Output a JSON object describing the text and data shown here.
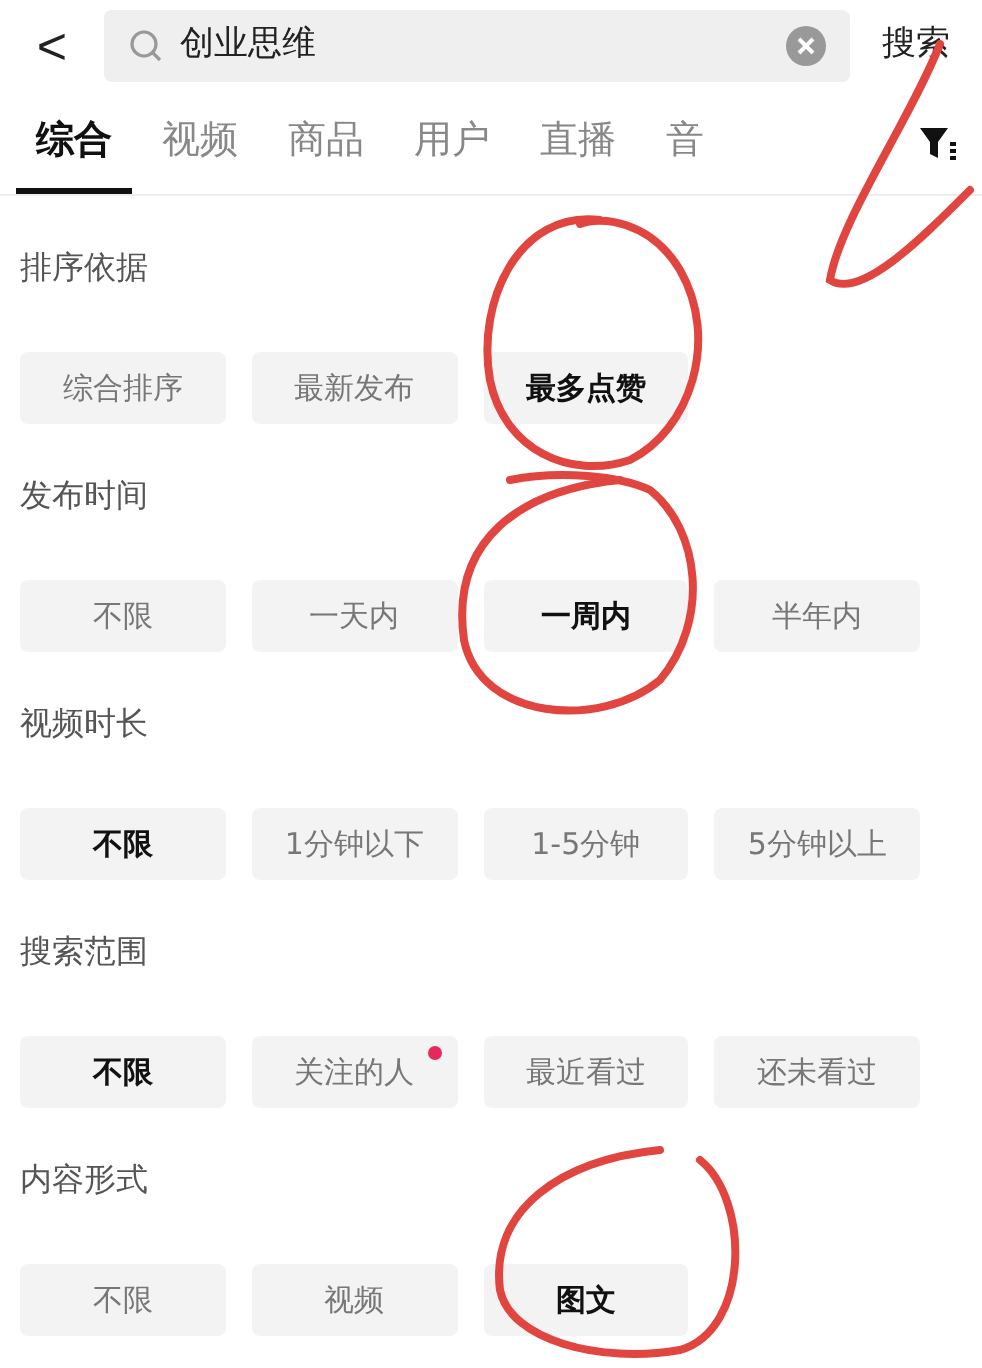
{
  "search_bar": {
    "back": "<",
    "value": "创业思维",
    "submit": "搜索"
  },
  "tabs": [
    {
      "label": "综合",
      "selected": true
    },
    {
      "label": "视频",
      "selected": false
    },
    {
      "label": "商品",
      "selected": false
    },
    {
      "label": "用户",
      "selected": false
    },
    {
      "label": "直播",
      "selected": false
    },
    {
      "label": "音",
      "selected": false
    }
  ],
  "filters": [
    {
      "title": "排序依据",
      "options": [
        {
          "label": "综合排序",
          "selected": false,
          "dot": false
        },
        {
          "label": "最新发布",
          "selected": false,
          "dot": false
        },
        {
          "label": "最多点赞",
          "selected": true,
          "dot": false
        }
      ]
    },
    {
      "title": "发布时间",
      "options": [
        {
          "label": "不限",
          "selected": false,
          "dot": false
        },
        {
          "label": "一天内",
          "selected": false,
          "dot": false
        },
        {
          "label": "一周内",
          "selected": true,
          "dot": false
        },
        {
          "label": "半年内",
          "selected": false,
          "dot": false
        }
      ]
    },
    {
      "title": "视频时长",
      "options": [
        {
          "label": "不限",
          "selected": true,
          "dot": false
        },
        {
          "label": "1分钟以下",
          "selected": false,
          "dot": false
        },
        {
          "label": "1-5分钟",
          "selected": false,
          "dot": false
        },
        {
          "label": "5分钟以上",
          "selected": false,
          "dot": false
        }
      ]
    },
    {
      "title": "搜索范围",
      "options": [
        {
          "label": "不限",
          "selected": true,
          "dot": false
        },
        {
          "label": "关注的人",
          "selected": false,
          "dot": true
        },
        {
          "label": "最近看过",
          "selected": false,
          "dot": false
        },
        {
          "label": "还未看过",
          "selected": false,
          "dot": false
        }
      ]
    },
    {
      "title": "内容形式",
      "options": [
        {
          "label": "不限",
          "selected": false,
          "dot": false
        },
        {
          "label": "视频",
          "selected": false,
          "dot": false
        },
        {
          "label": "图文",
          "selected": true,
          "dot": false
        }
      ]
    }
  ]
}
